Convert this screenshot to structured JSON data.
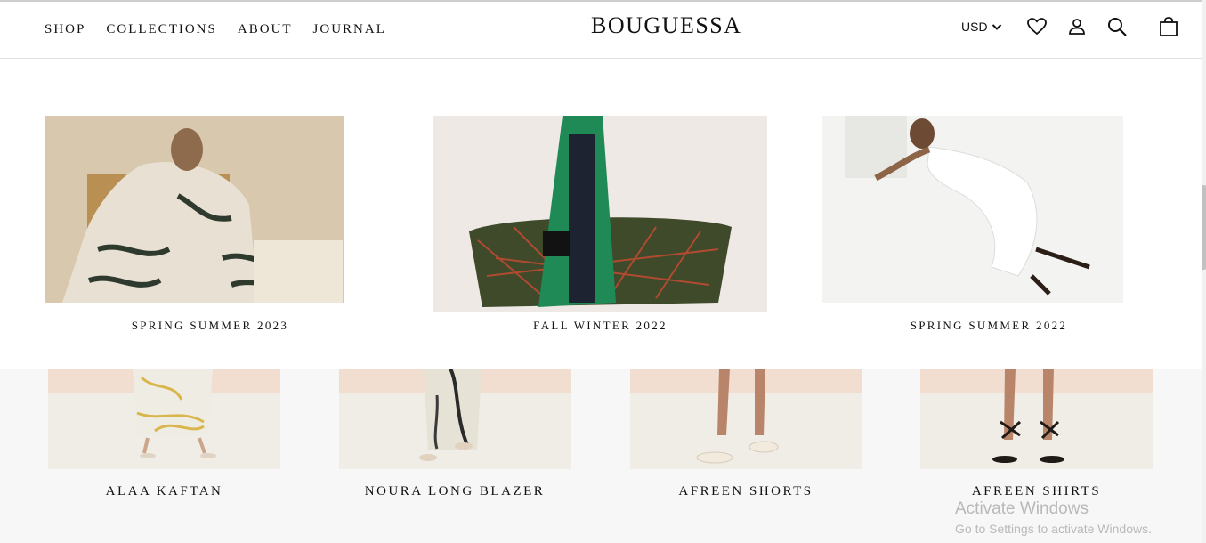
{
  "nav": {
    "items": [
      "SHOP",
      "COLLECTIONS",
      "ABOUT",
      "JOURNAL"
    ]
  },
  "brand": {
    "logo": "BOUGUESSA"
  },
  "header_actions": {
    "currency": "USD",
    "icons": [
      "heart-icon",
      "account-icon",
      "search-icon",
      "bag-icon"
    ]
  },
  "collections": [
    {
      "title": "SPRING SUMMER 2023"
    },
    {
      "title": "FALL WINTER 2022"
    },
    {
      "title": "SPRING SUMMER 2022"
    }
  ],
  "products": [
    {
      "title": "ALAA KAFTAN"
    },
    {
      "title": "NOURA LONG BLAZER"
    },
    {
      "title": "AFREEN SHORTS"
    },
    {
      "title": "AFREEN SHIRTS"
    }
  ],
  "os_watermark": {
    "title": "Activate Windows",
    "subtitle": "Go to Settings to activate Windows."
  },
  "colors": {
    "text": "#111111",
    "collection_bg_ss23": "#d8c9b0",
    "collection_bg_fw22": "#eee8e4",
    "collection_bg_ss22": "#f2f2f0",
    "lower_bg": "#f7f7f7"
  }
}
